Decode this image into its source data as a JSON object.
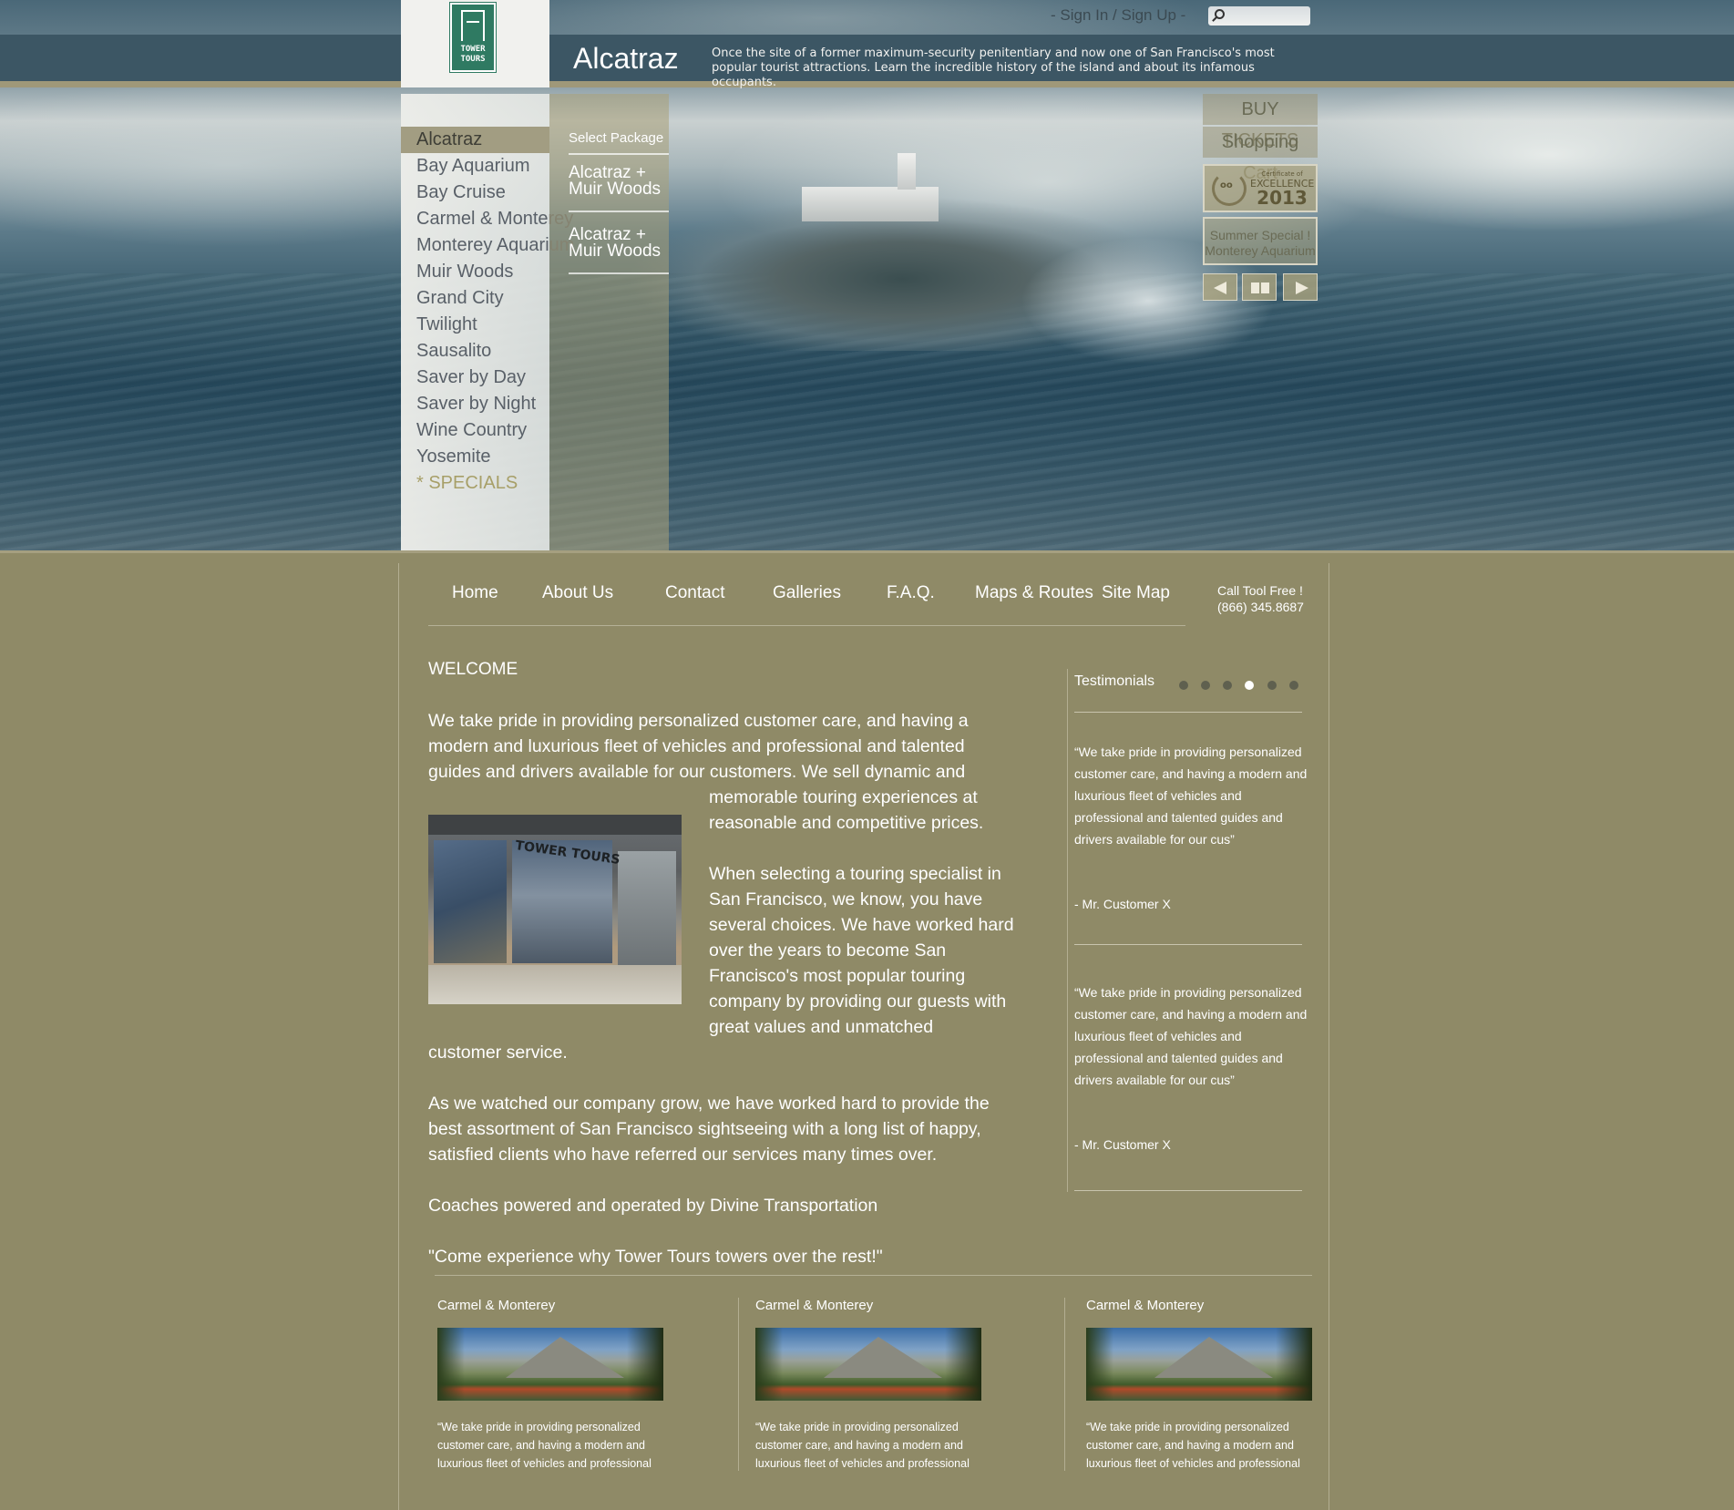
{
  "header": {
    "signin": "- Sign In / Sign Up  -",
    "search_placeholder": "",
    "logo_text": "TOWER\nTOURS",
    "page_name": "Alcatraz",
    "page_desc": "Once the site of a former maximum-security penitentiary and now one of San Francisco's most popular tourist attractions. Learn the incredible history of the island and about its infamous occupants."
  },
  "left_menu": {
    "items": [
      "Alcatraz",
      "Bay Aquarium",
      "Bay Cruise",
      "Carmel & Monterey",
      "Monterey Aquarium",
      "Muir Woods",
      "Grand City",
      "Twilight",
      "Sausalito",
      "Saver by Day",
      "Saver by Night",
      "Wine Country",
      "Yosemite",
      "* SPECIALS"
    ],
    "active": "Alcatraz"
  },
  "packages": {
    "title": "Select Package",
    "items": [
      "Alcatraz +\nMuir Woods",
      "Alcatraz +\nMuir Woods"
    ]
  },
  "right_tools": {
    "buy": "BUY TICKETS",
    "cart": "Shopping Cart",
    "badge": {
      "cert": "Certificate of",
      "excellence": "EXCELLENCE",
      "year": "2013",
      "brand": "tripadvisor"
    },
    "summer": "Summer Special !\nMonterey Aquarium"
  },
  "nav": {
    "items": [
      "Home",
      "About Us",
      "Contact",
      "Galleries",
      "F.A.Q.",
      "Maps & Routes",
      "Site Map"
    ],
    "call_label": "Call Tool Free !",
    "call_number": "(866) 345.8687"
  },
  "welcome": {
    "heading": "WELCOME",
    "p1_a": "We take pride in providing personalized customer care, and having a modern and luxurious fleet of vehicles and professional and talented guides and drivers available for our customers. We sell dynamic and",
    "p1_b": "memorable touring experiences at reasonable and competitive prices.",
    "p2": "When selecting a touring specialist in San Francisco, we know, you have several choices. We have worked hard over the years to become San Francisco's most popular touring company by providing our guests with great values and unmatched",
    "p2_end": "customer service.",
    "p3": "As we watched our company grow, we have worked hard to provide the best assortment of San Francisco sightseeing with a long list of happy, satisfied clients who have referred our services many times over.",
    "p4": "Coaches powered and operated by Divine Transportation",
    "p5": "\"Come experience why Tower Tours towers over the rest!\"",
    "store_sign": "TOWER TOURS"
  },
  "testimonials": {
    "title": "Testimonials",
    "dots": 6,
    "active_dot": 4,
    "items": [
      {
        "quote": "“We take pride in providing personalized customer care, and having a modern and luxurious fleet of vehicles and professional and talented guides and drivers available for our cus”",
        "author": "-  Mr. Customer X"
      },
      {
        "quote": "“We take pride in providing personalized customer care, and having a modern and luxurious fleet of vehicles and professional and talented guides and drivers available for our cus”",
        "author": "-  Mr. Customer X"
      }
    ]
  },
  "cards": [
    {
      "title": "Carmel & Monterey",
      "text": "“We take pride in providing personalized customer care, and having a modern and luxurious fleet of vehicles and professional"
    },
    {
      "title": "Carmel & Monterey",
      "text": "“We take pride in providing personalized customer care, and having a modern and luxurious fleet of vehicles and professional"
    },
    {
      "title": "Carmel & Monterey",
      "text": "“We take pride in providing personalized customer care, and having a modern and luxurious fleet of vehicles and professional"
    }
  ]
}
